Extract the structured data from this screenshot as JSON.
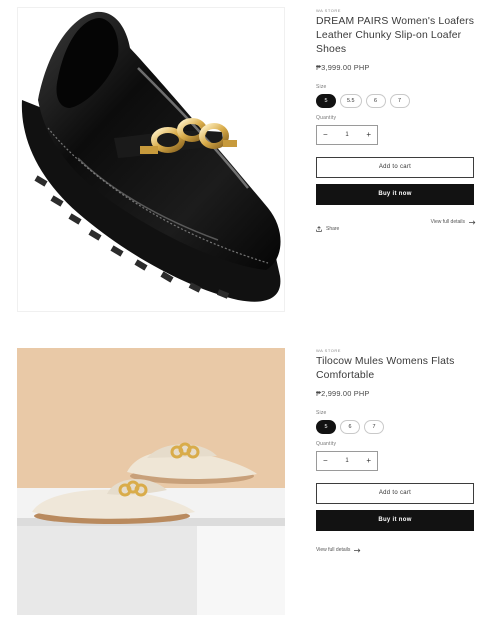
{
  "products": [
    {
      "vendor": "WA STORE",
      "title": "DREAM PAIRS Women's Loafers Leather Chunky Slip-on Loafer Shoes",
      "price": "₱3,999.00 PHP",
      "size_label": "Size",
      "sizes": [
        "5",
        "5.5",
        "6",
        "7"
      ],
      "selected_size": "5",
      "quantity_label": "Quantity",
      "quantity": "1",
      "minus": "−",
      "plus": "+",
      "add_to_cart": "Add to cart",
      "buy_now": "Buy it now",
      "share": "Share",
      "view_full": "View full details"
    },
    {
      "vendor": "WA STORE",
      "title": "Tilocow Mules Womens Flats Comfortable",
      "price": "₱2,999.00 PHP",
      "size_label": "Size",
      "sizes": [
        "5",
        "6",
        "7"
      ],
      "selected_size": "5",
      "quantity_label": "Quantity",
      "quantity": "1",
      "minus": "−",
      "plus": "+",
      "add_to_cart": "Add to cart",
      "buy_now": "Buy it now",
      "view_full": "View full details"
    }
  ],
  "icons": {
    "share": "share-icon",
    "arrow": "arrow-right-icon"
  },
  "colors": {
    "button_dark": "#121212",
    "backdrop_tan": "#e9c9a7",
    "pedestal": "#e6e6e6"
  }
}
